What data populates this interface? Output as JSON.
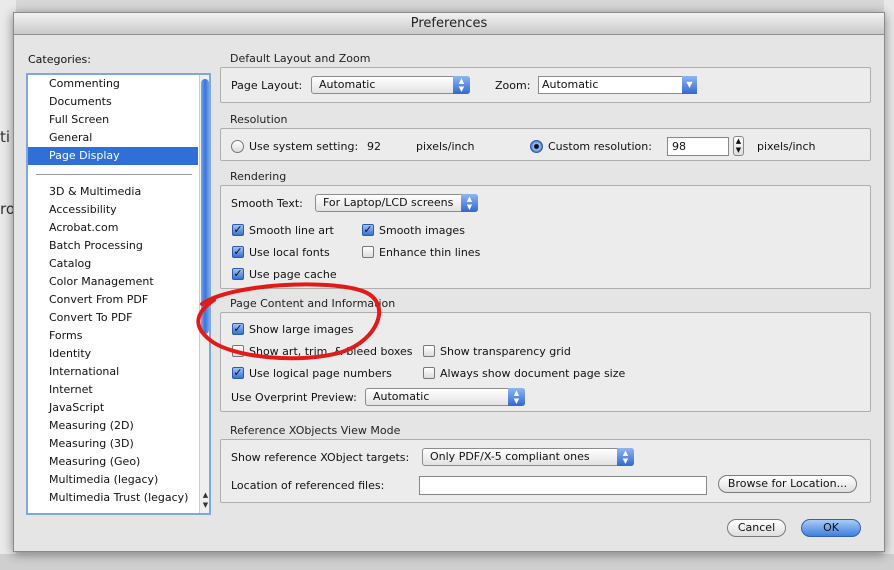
{
  "background": {
    "left_fragments": [
      "ti",
      "ro"
    ]
  },
  "window": {
    "title": "Preferences"
  },
  "categories": {
    "label": "Categories:",
    "top_items": [
      "Commenting",
      "Documents",
      "Full Screen",
      "General",
      "Page Display"
    ],
    "selected": "Page Display",
    "items": [
      "3D & Multimedia",
      "Accessibility",
      "Acrobat.com",
      "Batch Processing",
      "Catalog",
      "Color Management",
      "Convert From PDF",
      "Convert To PDF",
      "Forms",
      "Identity",
      "International",
      "Internet",
      "JavaScript",
      "Measuring (2D)",
      "Measuring (3D)",
      "Measuring (Geo)",
      "Multimedia (legacy)",
      "Multimedia Trust (legacy)"
    ]
  },
  "default_layout": {
    "title": "Default Layout and Zoom",
    "page_layout_label": "Page Layout:",
    "page_layout_value": "Automatic",
    "zoom_label": "Zoom:",
    "zoom_value": "Automatic"
  },
  "resolution": {
    "title": "Resolution",
    "system_label": "Use system setting:",
    "system_value": "92",
    "system_unit": "pixels/inch",
    "custom_label": "Custom resolution:",
    "custom_value": "98",
    "custom_unit": "pixels/inch",
    "selected": "custom"
  },
  "rendering": {
    "title": "Rendering",
    "smooth_text_label": "Smooth Text:",
    "smooth_text_value": "For Laptop/LCD screens",
    "smooth_line_art": {
      "label": "Smooth line art",
      "checked": true
    },
    "smooth_images": {
      "label": "Smooth images",
      "checked": true
    },
    "use_local_fonts": {
      "label": "Use local fonts",
      "checked": true
    },
    "enhance_thin_lines": {
      "label": "Enhance thin lines",
      "checked": false
    },
    "use_page_cache": {
      "label": "Use page cache",
      "checked": true
    }
  },
  "page_content": {
    "title": "Page Content and Information",
    "show_large_images": {
      "label": "Show large images",
      "checked": true
    },
    "show_art_trim_bleed": {
      "label": "Show art, trim, & bleed boxes",
      "checked": false
    },
    "show_transparency_grid": {
      "label": "Show transparency grid",
      "checked": false
    },
    "use_logical_page_numbers": {
      "label": "Use logical page numbers",
      "checked": true
    },
    "always_show_page_size": {
      "label": "Always show document page size",
      "checked": false
    },
    "overprint_label": "Use Overprint Preview:",
    "overprint_value": "Automatic"
  },
  "xobjects": {
    "title": "Reference XObjects View Mode",
    "targets_label": "Show reference XObject targets:",
    "targets_value": "Only PDF/X-5 compliant ones",
    "location_label": "Location of referenced files:",
    "location_value": "",
    "browse_label": "Browse for Location..."
  },
  "buttons": {
    "cancel": "Cancel",
    "ok": "OK"
  },
  "colors": {
    "selection": "#2f6fd7",
    "annotation": "#e21a1a"
  }
}
